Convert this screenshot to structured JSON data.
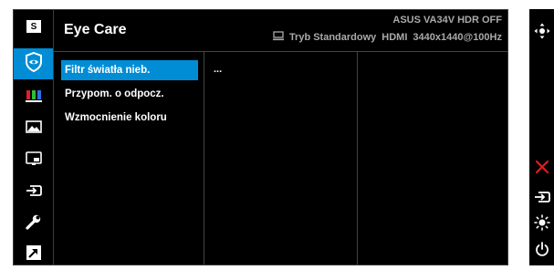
{
  "header": {
    "title": "Eye Care",
    "model": "ASUS  VA34V HDR OFF",
    "mode": "Tryb Standardowy",
    "input": "HDMI",
    "resolution": "3440x1440@100Hz"
  },
  "sidebar": {
    "items": [
      {
        "icon": "splendid-icon"
      },
      {
        "icon": "eye-care-icon",
        "selected": true
      },
      {
        "icon": "color-icon"
      },
      {
        "icon": "image-icon"
      },
      {
        "icon": "pip-icon"
      },
      {
        "icon": "input-select-icon"
      },
      {
        "icon": "system-setup-icon"
      },
      {
        "icon": "shortcut-icon"
      }
    ]
  },
  "menu": {
    "items": [
      {
        "label": "Filtr światła nieb.",
        "selected": true
      },
      {
        "label": "Przypom. o odpocz."
      },
      {
        "label": "Wzmocnienie koloru"
      }
    ]
  },
  "submenu": {
    "value": "..."
  },
  "right_bar": {
    "icons": [
      "navigate-joystick-icon",
      "close-icon",
      "input-icon",
      "brightness-icon",
      "power-icon"
    ]
  },
  "colors": {
    "accent": "#008dd6",
    "close": "#e01c1c",
    "header_text": "#a9a9a9"
  }
}
